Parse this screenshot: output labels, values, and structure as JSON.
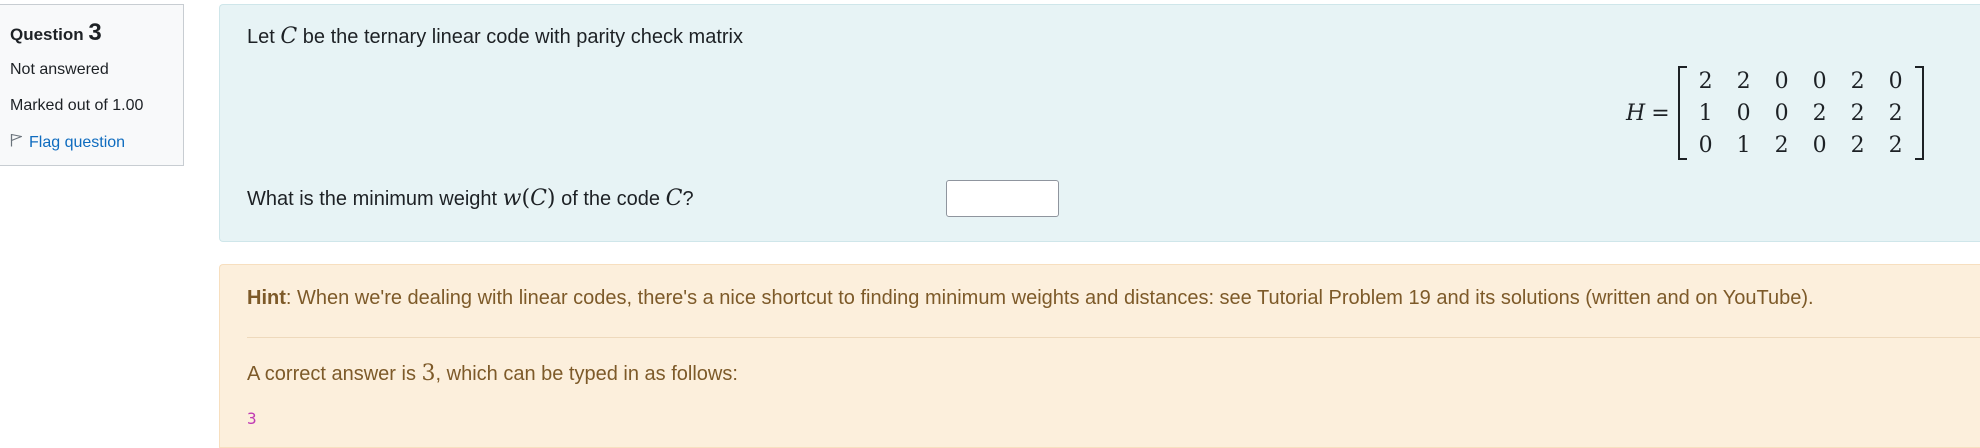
{
  "info": {
    "question_label": "Question",
    "question_number": "3",
    "state": "Not answered",
    "grade": "Marked out of 1.00",
    "flag_label": "Flag question"
  },
  "question": {
    "intro_before": "Let",
    "code_symbol": "C",
    "intro_after": "be the ternary linear code with parity check matrix",
    "matrix_label": "H",
    "matrix_eq": "=",
    "matrix_rows": [
      [
        "2",
        "2",
        "0",
        "0",
        "2",
        "0"
      ],
      [
        "1",
        "0",
        "0",
        "2",
        "2",
        "2"
      ],
      [
        "0",
        "1",
        "2",
        "0",
        "2",
        "2"
      ]
    ],
    "prompt_before": "What is the minimum weight",
    "weight_w": "w",
    "weight_paren_open": "(",
    "weight_C": "C",
    "weight_paren_close": ")",
    "prompt_middle": "of the code",
    "prompt_end": "?",
    "answer_value": ""
  },
  "feedback": {
    "hint_title": "Hint",
    "hint_text": ": When we're dealing with linear codes, there's a nice shortcut to finding minimum weights and distances: see Tutorial Problem 19 and its solutions (written and on YouTube).",
    "right_before": "A correct answer is",
    "right_value": "3",
    "right_after": ", which can be typed in as follows:",
    "typed_answer": "3"
  }
}
